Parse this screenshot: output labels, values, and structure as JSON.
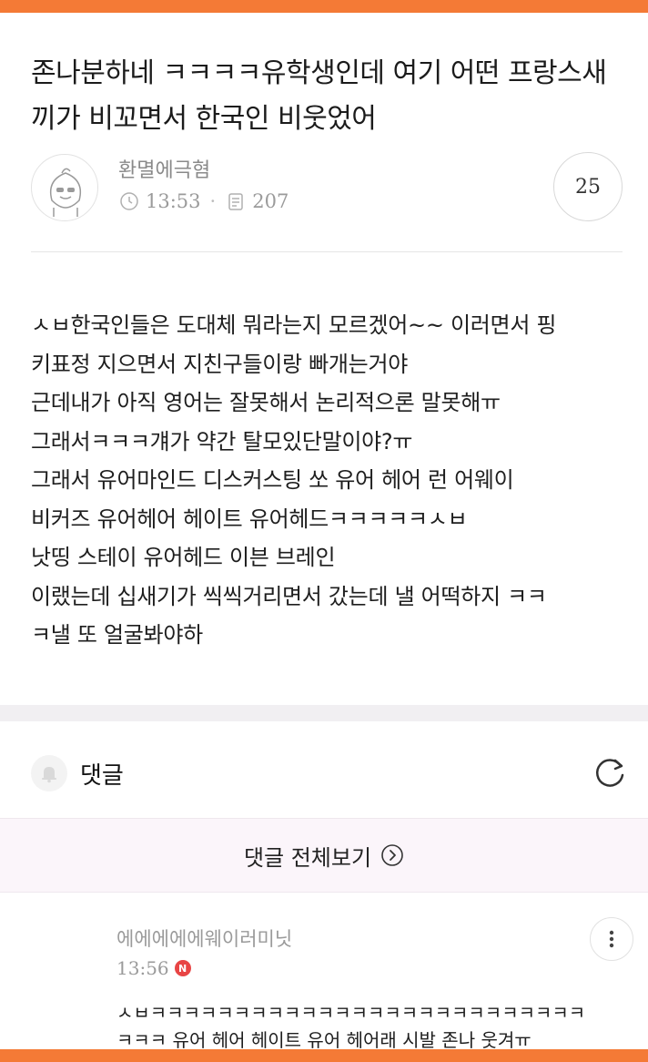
{
  "post": {
    "title": "존나분하네 ㅋㅋㅋㅋ유학생인데 여기 어떤 프랑스새끼가 비꼬면서 한국인 비웃었어",
    "author": "환멸에극혐",
    "time": "13:53",
    "views": "207",
    "comment_count": "25",
    "body_lines": [
      "ㅅㅂ한국인들은 도대체 뭐라는지 모르겠어~~ 이러면서 핑",
      "키표정 지으면서 지친구들이랑 빠개는거야",
      "근데내가 아직 영어는 잘못해서 논리적으론 말못해ㅠ",
      "그래서ㅋㅋㅋ걔가 약간 탈모있단말이야?ㅠ",
      "그래서 유어마인드 디스커스팅 쏘 유어 헤어 런 어웨이",
      "비커즈 유어헤어 헤이트 유어헤드ㅋㅋㅋㅋㅋㅅㅂ",
      "낫띵 스테이 유어헤드 이븐 브레인",
      "이랬는데 십새기가 씩씩거리면서 갔는데 낼 어떡하지 ㅋㅋ",
      "ㅋ낼 또 얼굴봐야하"
    ]
  },
  "comments_section": {
    "label": "댓글",
    "view_all_label": "댓글 전체보기"
  },
  "comment": {
    "author": "에에에에에웨이러미닛",
    "time": "13:56",
    "badge": "N",
    "lines": [
      "ㅅㅂㅋㅋㅋㅋㅋㅋㅋㅋㅋㅋㅋㅋㅋㅋㅋㅋㅋㅋㅋㅋㅋㅋㅋㅋㅋㅋ",
      "ㅋㅋㅋ 유어 헤어 헤이트 유어 헤어래 시발 존나 웃겨ㅠ"
    ]
  },
  "colors": {
    "accent_bar": "#f47a36",
    "badge_red": "#e84545",
    "view_all_bg": "#fbf5fa"
  },
  "icons": [
    "clock-icon",
    "document-icon",
    "bell-icon",
    "refresh-icon",
    "chevron-right-circle-icon",
    "more-vertical-icon"
  ]
}
